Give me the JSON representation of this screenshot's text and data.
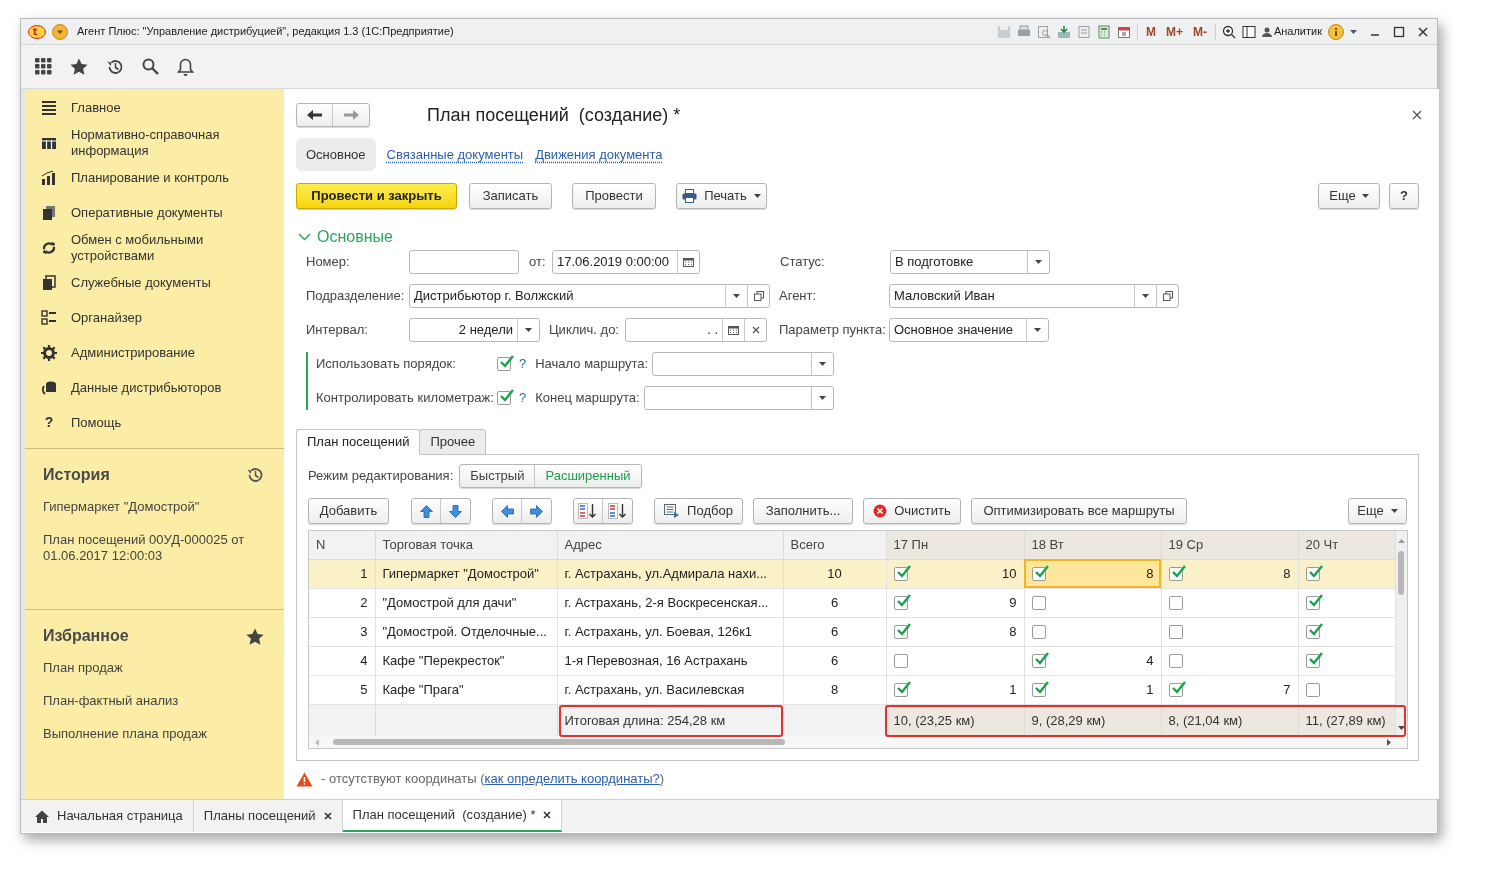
{
  "window": {
    "title": "Агент Плюс: \"Управление дистрибуцией\", редакция 1.3  (1С:Предприятие)"
  },
  "title_bar": {
    "memory_buttons": [
      "M",
      "M+",
      "M-"
    ],
    "user": "Аналитик"
  },
  "sidebar": {
    "menu": [
      {
        "label": "Главное"
      },
      {
        "label": "Нормативно-справочная информация"
      },
      {
        "label": "Планирование и контроль"
      },
      {
        "label": "Оперативные документы"
      },
      {
        "label": "Обмен с мобильными устройствами"
      },
      {
        "label": "Служебные документы"
      },
      {
        "label": "Органайзер"
      },
      {
        "label": "Администрирование"
      },
      {
        "label": "Данные дистрибьюторов"
      },
      {
        "label": "Помощь",
        "glyph": "?"
      }
    ],
    "history": {
      "title": "История",
      "items": [
        "Гипермаркет \"Домострой\"",
        "План посещений 00УД-000025 от 01.06.2017 12:00:03"
      ]
    },
    "favorites": {
      "title": "Избранное",
      "items": [
        "План продаж",
        "План-фактный анализ",
        "Выполнение плана продаж"
      ]
    }
  },
  "form": {
    "title": "План посещений  (создание) *",
    "sections": [
      {
        "label": "Основное",
        "selected": true
      },
      {
        "label": "Связанные документы",
        "selected": false
      },
      {
        "label": "Движения документа",
        "selected": false
      }
    ],
    "buttons": [
      {
        "label": "Провести и закрыть",
        "kind": "primary"
      },
      {
        "label": "Записать",
        "kind": "plain"
      },
      {
        "label": "Провести",
        "kind": "plain"
      },
      {
        "label": "Печать",
        "kind": "print"
      }
    ],
    "more": "Еще",
    "help": "?",
    "group": {
      "title": "Основные",
      "expanded": true
    },
    "number": {
      "label": "Номер:"
    },
    "date": {
      "label": "от:",
      "value": "17.06.2019  0:00:00"
    },
    "status": {
      "label": "Статус:",
      "value": "В подготовке"
    },
    "division": {
      "label": "Подразделение:",
      "value": "Дистрибьютор г. Волжский"
    },
    "agent": {
      "label": "Агент:",
      "value": "Маловский Иван"
    },
    "interval": {
      "label": "Интервал:",
      "value": "2 недели"
    },
    "cyclic_until": {
      "label": "Циклич. до:",
      "value": ".  ."
    },
    "point_parameter": {
      "label": "Параметр пункта:",
      "value": "Основное значение"
    },
    "use_order": {
      "label": "Использовать порядок:",
      "checked": true,
      "hint": "?"
    },
    "route_start": {
      "label": "Начало маршрута:"
    },
    "control_mileage": {
      "label": "Контролировать километраж:",
      "checked": true,
      "hint": "?"
    },
    "route_end": {
      "label": "Конец маршрута:"
    }
  },
  "tabs": [
    {
      "label": "План посещений",
      "selected": true
    },
    {
      "label": "Прочее",
      "selected": false
    }
  ],
  "edit_mode": {
    "label": "Режим редактирования:",
    "options": [
      {
        "label": "Быстрый",
        "selected": false
      },
      {
        "label": "Расширенный",
        "selected": true
      }
    ]
  },
  "table_toolbar": {
    "add": "Добавить",
    "pick": "Подбор",
    "fill": "Заполнить...",
    "clear": "Очистить",
    "optimize": "Оптимизировать все маршруты",
    "more": "Еще"
  },
  "table": {
    "columns": [
      "N",
      "Торговая точка",
      "Адрес",
      "Всего",
      "17 Пн",
      "18 Вт",
      "19 Ср",
      "20 Чт"
    ],
    "rows": [
      {
        "n": "1",
        "point": "Гипермаркет \"Домострой\"",
        "address": "г. Астрахань, ул.Адмирала нахи...",
        "total": "10",
        "selected": true,
        "days": [
          {
            "checked": true,
            "count": "10",
            "focused": false
          },
          {
            "checked": true,
            "count": "8",
            "focused": true
          },
          {
            "checked": true,
            "count": "8",
            "focused": false
          },
          {
            "checked": true,
            "focused": false
          }
        ]
      },
      {
        "n": "2",
        "point": "\"Домострой для дачи\"",
        "address": "г. Астрахань, 2-я Воскресенская...",
        "total": "6",
        "selected": false,
        "days": [
          {
            "checked": true,
            "count": "9",
            "focused": false
          },
          {
            "checked": false,
            "focused": false
          },
          {
            "checked": false,
            "focused": false
          },
          {
            "checked": true,
            "focused": false
          }
        ]
      },
      {
        "n": "3",
        "point": "\"Домострой. Отделочные...",
        "address": "г. Астрахань, ул. Боевая, 126к1",
        "total": "6",
        "selected": false,
        "days": [
          {
            "checked": true,
            "count": "8",
            "focused": false
          },
          {
            "checked": false,
            "focused": false
          },
          {
            "checked": false,
            "focused": false
          },
          {
            "checked": true,
            "focused": false
          }
        ]
      },
      {
        "n": "4",
        "point": "Кафе \"Перекресток\"",
        "address": "1-я Перевозная, 16 Астрахань",
        "total": "6",
        "selected": false,
        "days": [
          {
            "checked": false,
            "focused": false
          },
          {
            "checked": true,
            "count": "4",
            "focused": false
          },
          {
            "checked": false,
            "focused": false
          },
          {
            "checked": true,
            "focused": false
          }
        ]
      },
      {
        "n": "5",
        "point": "Кафе \"Прага\"",
        "address": "г. Астрахань, ул. Василевская",
        "total": "8",
        "selected": false,
        "days": [
          {
            "checked": true,
            "count": "1",
            "focused": false
          },
          {
            "checked": true,
            "count": "1",
            "focused": false
          },
          {
            "checked": true,
            "count": "7",
            "focused": false
          },
          {
            "checked": false,
            "focused": false
          }
        ]
      }
    ],
    "footer": {
      "summary": {
        "text": "Итоговая длина: 254,28 км",
        "highlighted": true
      },
      "day_totals": {
        "highlighted": true,
        "items": [
          "10, (23,25 км)",
          "9, (28,29 км)",
          "8, (21,04 км)",
          "11, (27,89 км)"
        ]
      }
    }
  },
  "note": {
    "text": "- отсутствуют координаты (",
    "link": "как определить координаты?",
    "after": ")"
  },
  "open_tabs": [
    {
      "label": "Начальная страница",
      "selected": false,
      "home": true,
      "closable": false
    },
    {
      "label": "Планы посещений",
      "selected": false,
      "home": false,
      "closable": true
    },
    {
      "label": "План посещений  (создание) *",
      "selected": true,
      "home": false,
      "closable": true
    }
  ]
}
